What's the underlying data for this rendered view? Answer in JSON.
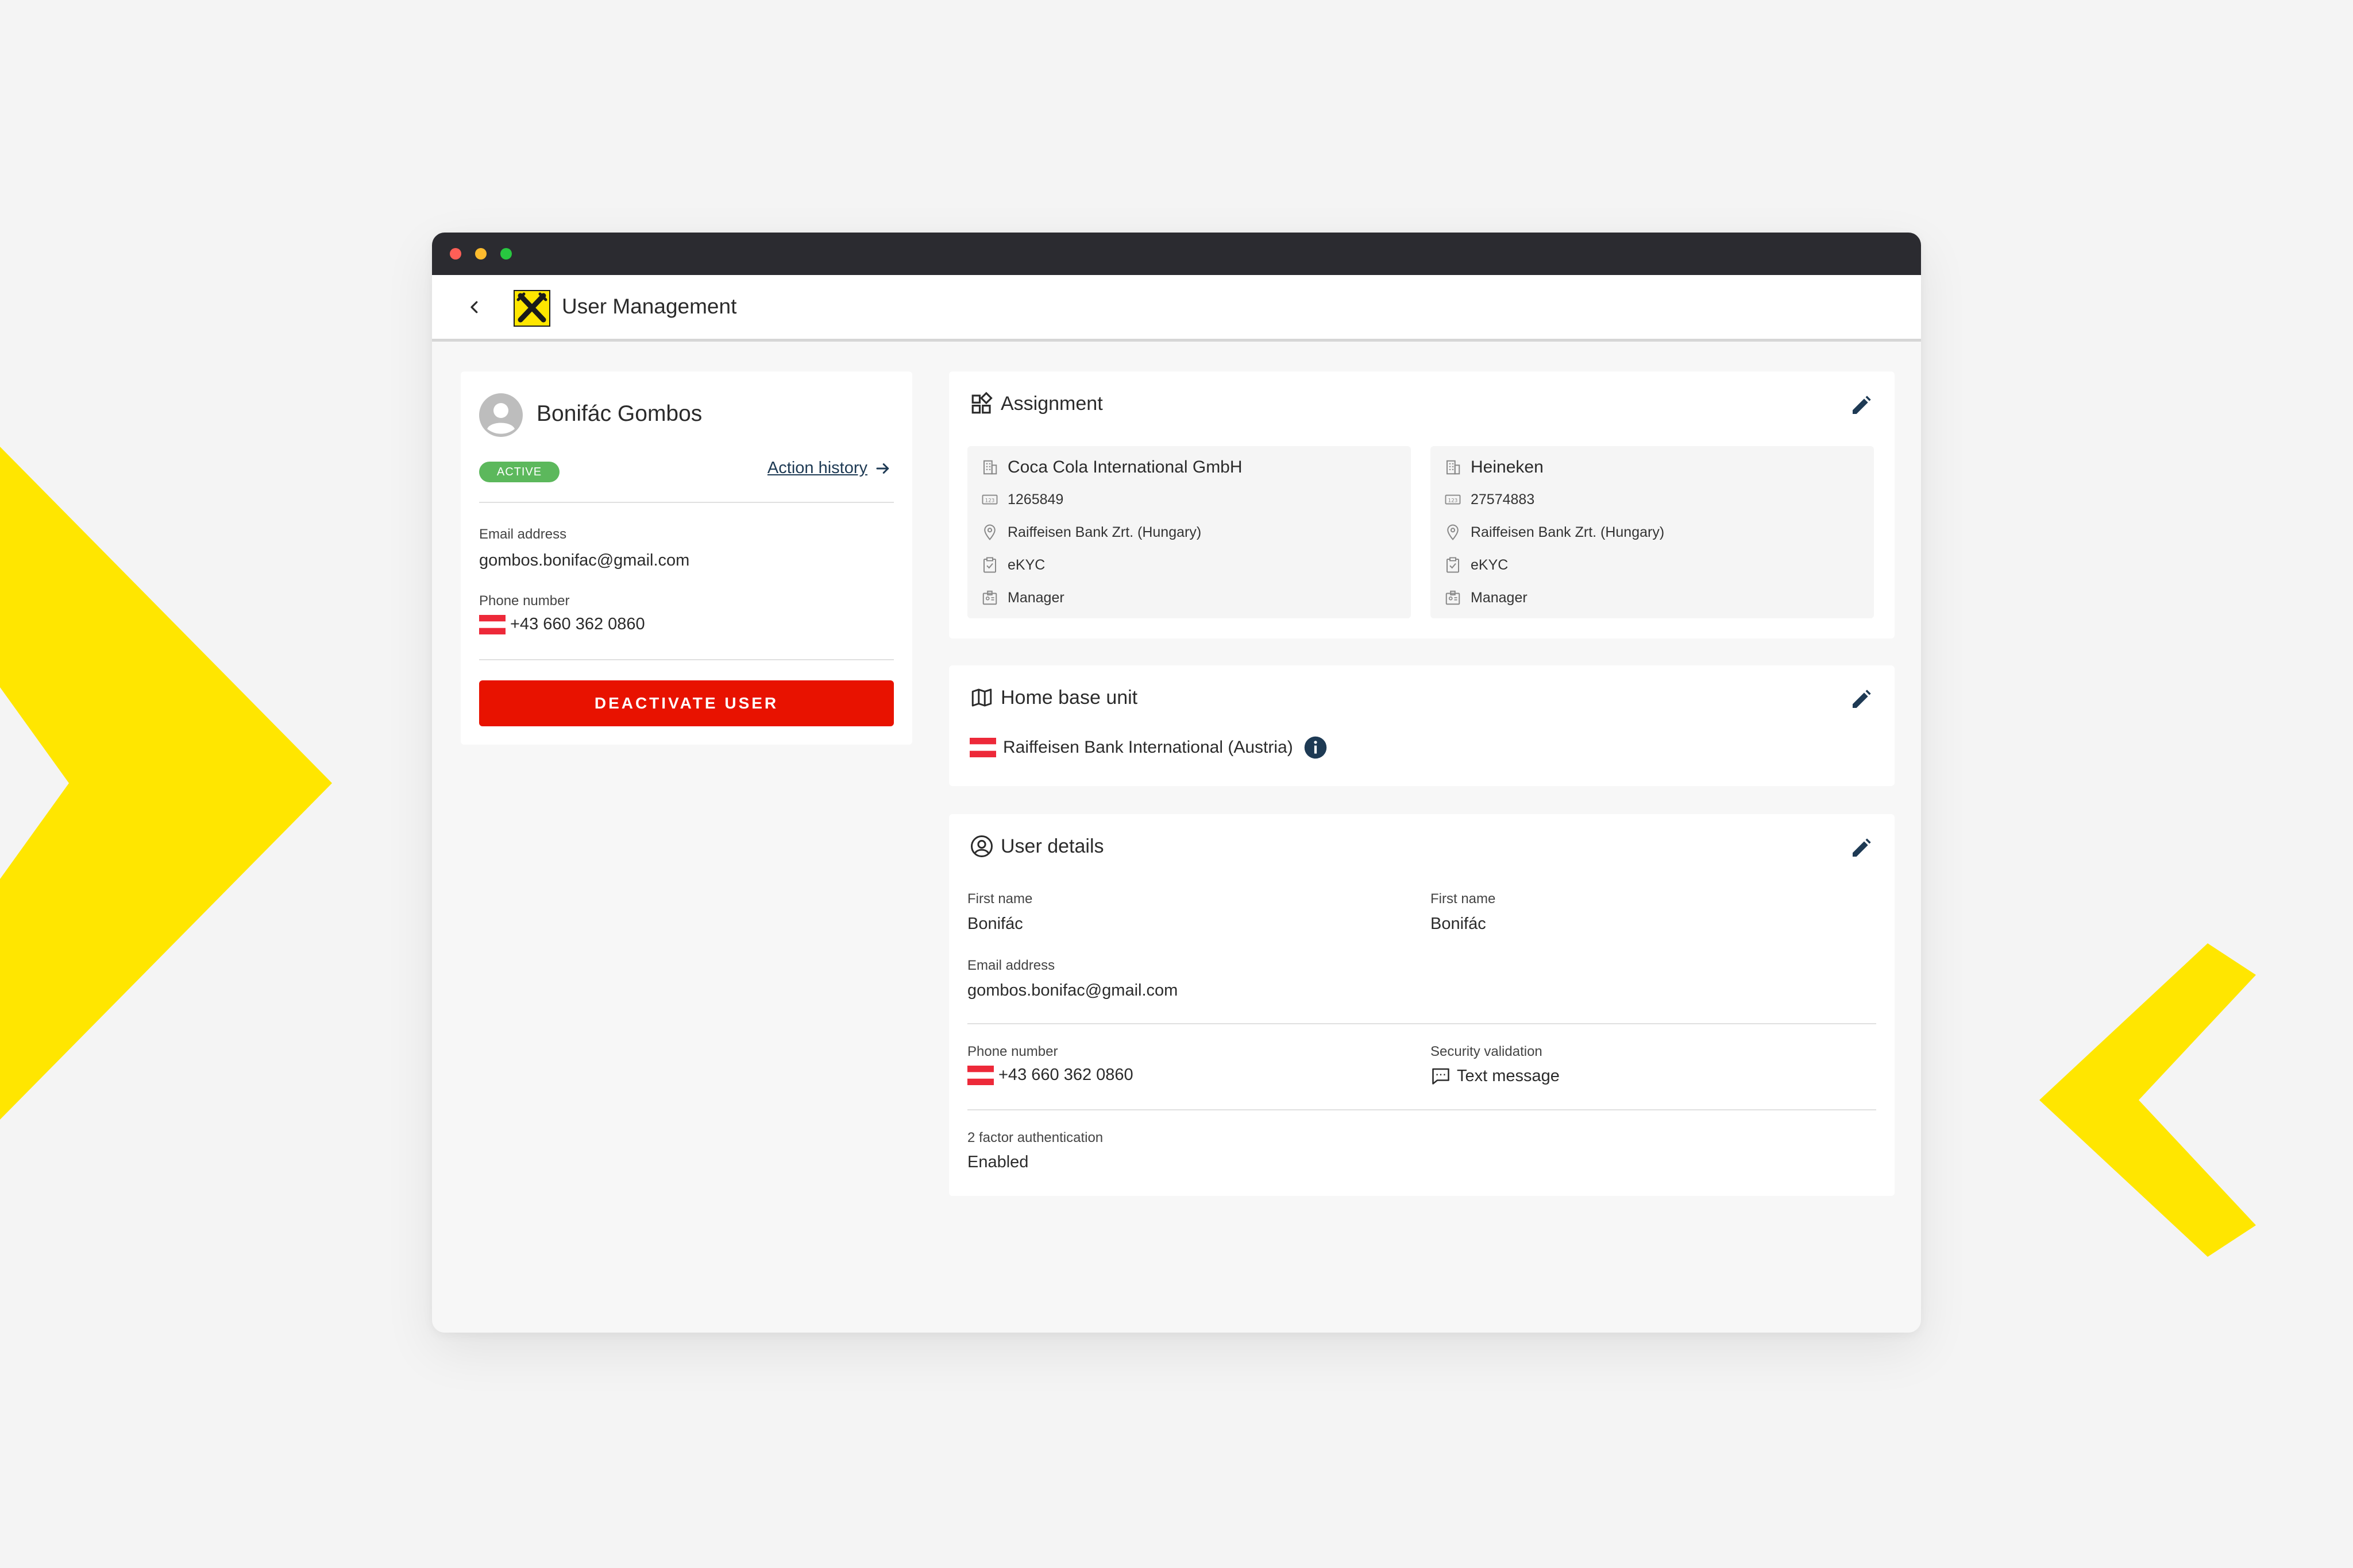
{
  "app": {
    "title": "User Management"
  },
  "profile": {
    "name": "Bonifác Gombos",
    "status": "ACTIVE",
    "action_history": "Action history",
    "email_label": "Email address",
    "email": "gombos.bonifac@gmail.com",
    "phone_label": "Phone number",
    "phone": "+43 660 362 0860",
    "deactivate": "DEACTIVATE USER"
  },
  "assignment": {
    "title": "Assignment",
    "orgs": [
      {
        "name": "Coca Cola International GmbH",
        "id": "1265849",
        "bank": "Raiffeisen Bank Zrt. (Hungary)",
        "kyc": "eKYC",
        "role": "Manager"
      },
      {
        "name": "Heineken",
        "id": "27574883",
        "bank": "Raiffeisen Bank Zrt. (Hungary)",
        "kyc": "eKYC",
        "role": "Manager"
      }
    ]
  },
  "home_base": {
    "title": "Home base unit",
    "value": "Raiffeisen Bank International (Austria)"
  },
  "user_details": {
    "title": "User details",
    "first_name_label": "First name",
    "first_name": "Bonifác",
    "second_name_label": "First name",
    "second_name": "Bonifác",
    "email_label": "Email address",
    "email": "gombos.bonifac@gmail.com",
    "phone_label": "Phone number",
    "phone": "+43 660 362 0860",
    "security_label": "Security validation",
    "security": "Text message",
    "twofa_label": "2 factor authentication",
    "twofa": "Enabled"
  },
  "colors": {
    "accent_yellow": "#ffe600",
    "danger": "#e81200",
    "active": "#5cb85c",
    "link": "#1e3a54",
    "titlebar": "#2b2b30"
  }
}
